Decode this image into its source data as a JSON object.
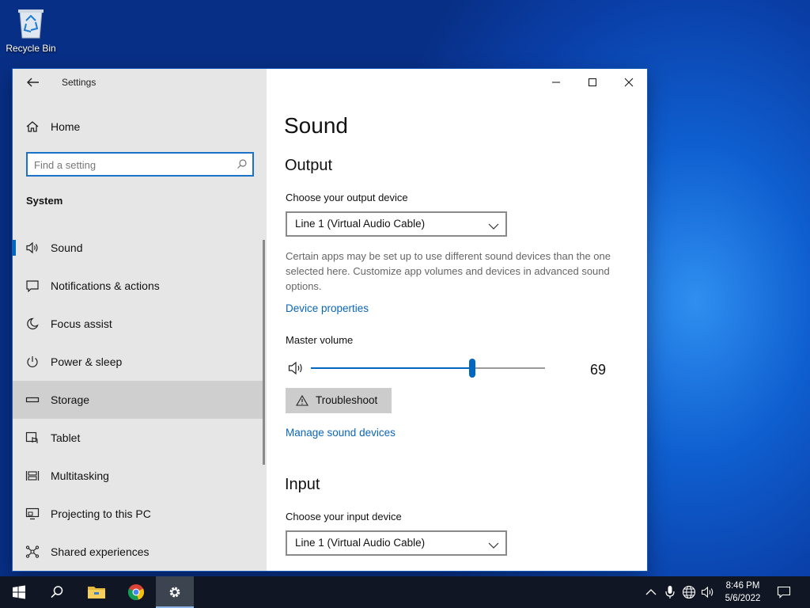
{
  "desktop": {
    "recycle_bin_label": "Recycle Bin"
  },
  "window": {
    "app_title": "Settings",
    "controls": {
      "minimize": "minimize",
      "maximize": "maximize",
      "close": "close"
    }
  },
  "sidebar": {
    "home_label": "Home",
    "search_placeholder": "Find a setting",
    "section_label": "System",
    "items": [
      {
        "label": "Sound",
        "icon": "speaker-icon",
        "active": true
      },
      {
        "label": "Notifications & actions",
        "icon": "notification-icon"
      },
      {
        "label": "Focus assist",
        "icon": "moon-icon"
      },
      {
        "label": "Power & sleep",
        "icon": "power-icon"
      },
      {
        "label": "Storage",
        "icon": "storage-icon",
        "hover": true
      },
      {
        "label": "Tablet",
        "icon": "tablet-icon"
      },
      {
        "label": "Multitasking",
        "icon": "multitasking-icon"
      },
      {
        "label": "Projecting to this PC",
        "icon": "projecting-icon"
      },
      {
        "label": "Shared experiences",
        "icon": "shared-experiences-icon"
      }
    ]
  },
  "content": {
    "title": "Sound",
    "output": {
      "heading": "Output",
      "device_label": "Choose your output device",
      "device_value": "Line 1 (Virtual Audio Cable)",
      "description": "Certain apps may be set up to use different sound devices than the one selected here. Customize app volumes and devices in advanced sound options.",
      "device_properties_link": "Device properties",
      "master_volume_label": "Master volume",
      "master_volume_value": "69",
      "volume_level": 0.69,
      "troubleshoot_label": "Troubleshoot",
      "manage_devices_link": "Manage sound devices"
    },
    "input": {
      "heading": "Input",
      "device_label": "Choose your input device",
      "device_value": "Line 1 (Virtual Audio Cable)"
    }
  },
  "taskbar": {
    "time": "8:46 PM",
    "date": "5/6/2022",
    "accent": "#0067c0"
  }
}
